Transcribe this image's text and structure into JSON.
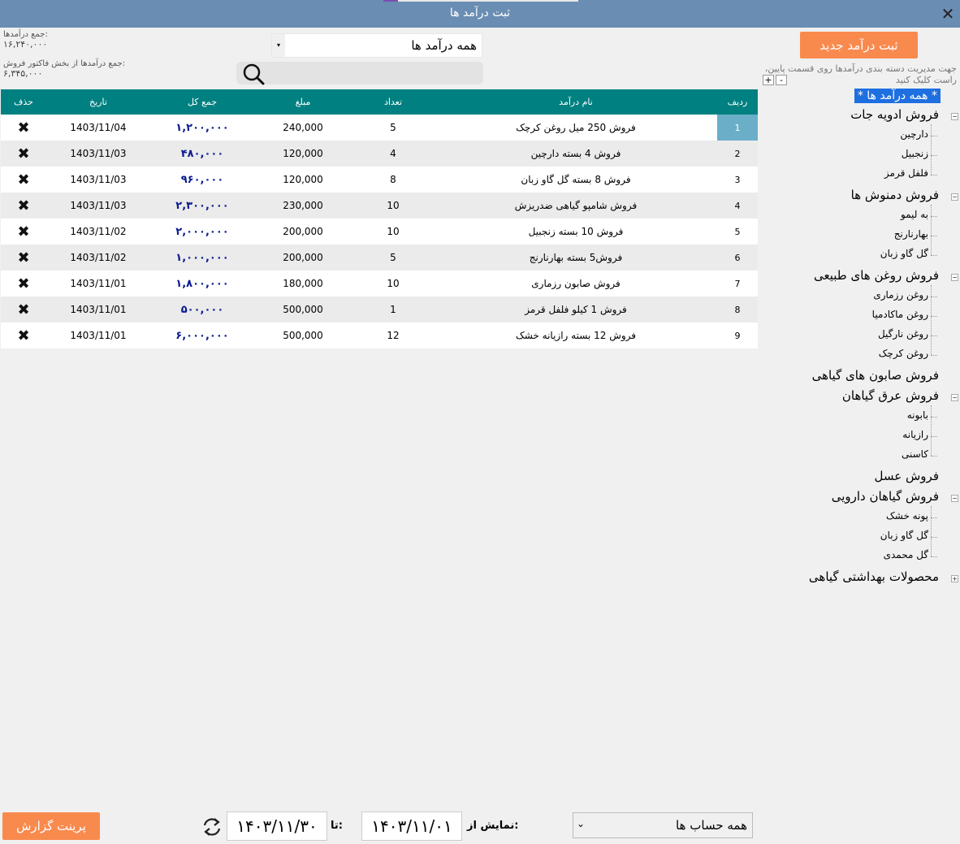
{
  "window": {
    "title": "ثبت درآمد ها",
    "close_label": "✕"
  },
  "totals": {
    "income_label": "جمع درآمدها:",
    "income_value": "۱۶,۲۴۰,۰۰۰",
    "invoice_label": "جمع درآمدها از بخش فاکتور فروش:",
    "invoice_value": "۶,۳۴۵,۰۰۰"
  },
  "filter": {
    "selected": "همه درآمد ها",
    "arrow": "▾"
  },
  "search": {
    "placeholder": "",
    "icon": "search-icon"
  },
  "table": {
    "headers": [
      "ردیف",
      "نام درآمد",
      "تعداد",
      "مبلغ",
      "جمع کل",
      "تاریخ",
      "حذف"
    ],
    "rows": [
      {
        "n": "1",
        "name": "فروش 250 میل روغن کرچک",
        "qty": "5",
        "price": "240,000",
        "total": "۱,۲۰۰,۰۰۰",
        "date": "1403/11/04",
        "del": "✖"
      },
      {
        "n": "2",
        "name": "فروش 4 بسته دارچین",
        "qty": "4",
        "price": "120,000",
        "total": "۴۸۰,۰۰۰",
        "date": "1403/11/03",
        "del": "✖"
      },
      {
        "n": "3",
        "name": "فروش 8 بسته گل گاو زبان",
        "qty": "8",
        "price": "120,000",
        "total": "۹۶۰,۰۰۰",
        "date": "1403/11/03",
        "del": "✖"
      },
      {
        "n": "4",
        "name": "فروش شامپو گیاهی ضدریزش",
        "qty": "10",
        "price": "230,000",
        "total": "۲,۳۰۰,۰۰۰",
        "date": "1403/11/03",
        "del": "✖"
      },
      {
        "n": "5",
        "name": "فروش 10 بسته زنجبیل",
        "qty": "10",
        "price": "200,000",
        "total": "۲,۰۰۰,۰۰۰",
        "date": "1403/11/02",
        "del": "✖"
      },
      {
        "n": "6",
        "name": "فروش5 بسته بهارنارنج",
        "qty": "5",
        "price": "200,000",
        "total": "۱,۰۰۰,۰۰۰",
        "date": "1403/11/02",
        "del": "✖"
      },
      {
        "n": "7",
        "name": "فروش صابون رزماری",
        "qty": "10",
        "price": "180,000",
        "total": "۱,۸۰۰,۰۰۰",
        "date": "1403/11/01",
        "del": "✖"
      },
      {
        "n": "8",
        "name": "فروش 1 کیلو فلفل قرمز",
        "qty": "1",
        "price": "500,000",
        "total": "۵۰۰,۰۰۰",
        "date": "1403/11/01",
        "del": "✖"
      },
      {
        "n": "9",
        "name": "فروش 12 بسته رازیانه خشک",
        "qty": "12",
        "price": "500,000",
        "total": "۶,۰۰۰,۰۰۰",
        "date": "1403/11/01",
        "del": "✖"
      }
    ]
  },
  "side": {
    "new_button": "ثبت درآمد جدید",
    "hint": "جهت مدیریت دسته بندی درآمدها روی قسمت پایین، راست کلیک کنید",
    "plus": "+",
    "minus": "-"
  },
  "tree": {
    "root": "* همه درآمد ها *",
    "groups": [
      {
        "label": "فروش ادویه جات",
        "children": [
          "دارچین",
          "زنجبیل",
          "فلفل قرمز"
        ]
      },
      {
        "label": "فروش دمنوش ها",
        "children": [
          "به لیمو",
          "بهارنارنج",
          "گل گاو زبان"
        ]
      },
      {
        "label": "فروش روغن های طبیعی",
        "children": [
          "روغن رزماری",
          "روغن ماکادمیا",
          "روغن نارگیل",
          "روغن کرچک"
        ]
      },
      {
        "label": "فروش صابون های گیاهی",
        "children": []
      },
      {
        "label": "فروش عرق گیاهان",
        "children": [
          "بابونه",
          "رازیانه",
          "کاسنی"
        ]
      },
      {
        "label": "فروش عسل",
        "children": []
      },
      {
        "label": "فروش گیاهان دارویی",
        "children": [
          "پونه خشک",
          "گل گاو زبان",
          "گل محمدی"
        ]
      },
      {
        "label": "محصولات بهداشتی گیاهی",
        "children": []
      }
    ]
  },
  "footer": {
    "print_button": "پرینت گزارش",
    "to_label": "تا:",
    "to_date": "۱۴۰۳/۱۱/۳۰",
    "from_label": "نمایش از:",
    "from_date": "۱۴۰۳/۱۱/۰۱",
    "account_select": "همه حساب ها",
    "account_arrow": "⌄"
  },
  "colors": {
    "titlebar": "#6a8db3",
    "header": "#008080",
    "accent_button": "#f98a4e",
    "tree_selected": "#1e6fe0",
    "row_selected": "#6aaec8",
    "total_text": "#0a1a8f"
  }
}
